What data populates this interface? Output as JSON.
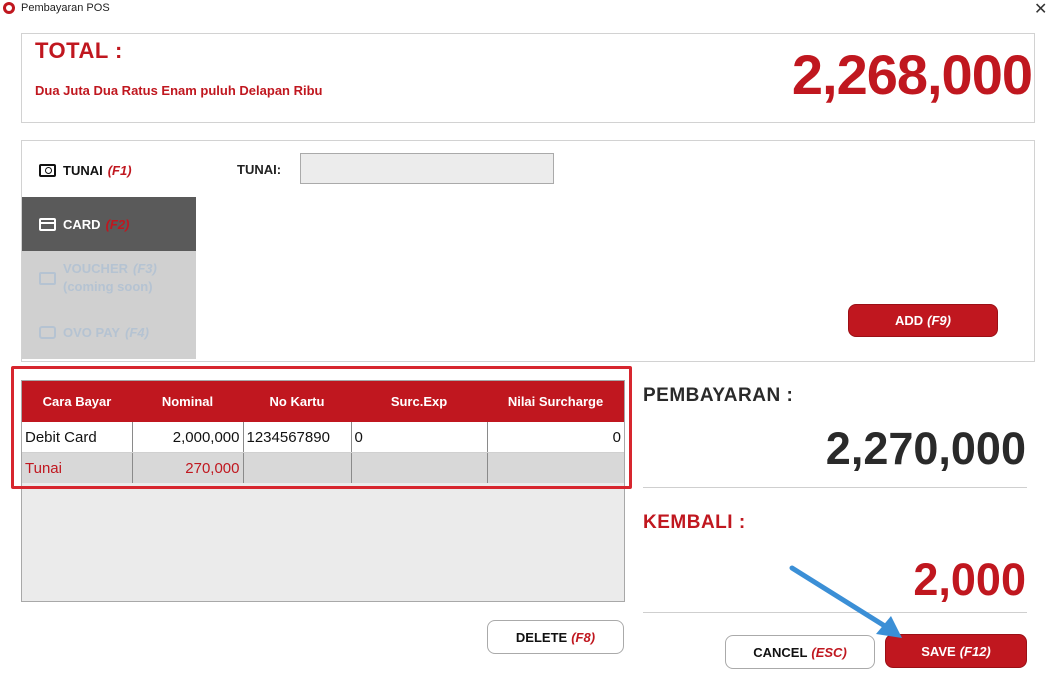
{
  "window": {
    "title": "Pembayaran POS",
    "close_glyph": "✕"
  },
  "total": {
    "label": "TOTAL :",
    "amount_words": "Dua Juta Dua Ratus Enam puluh Delapan Ribu",
    "amount": "2,268,000"
  },
  "methods": [
    {
      "label": "TUNAI",
      "key": "(F1)",
      "icon": "cash-icon"
    },
    {
      "label": "CARD",
      "key": "(F2)",
      "icon": "card-icon",
      "selected": true
    },
    {
      "label": "VOUCHER",
      "key": "(F3)",
      "sub": "(coming soon)",
      "icon": "voucher-icon",
      "disabled": true
    },
    {
      "label": "OVO PAY",
      "key": "(F4)",
      "icon": "wallet-icon",
      "disabled": true
    }
  ],
  "tunai_field": {
    "label": "TUNAI:",
    "value": ""
  },
  "buttons": {
    "add": {
      "label": "ADD",
      "key": "(F9)"
    },
    "delete": {
      "label": "DELETE",
      "key": "(F8)"
    },
    "cancel": {
      "label": "CANCEL",
      "key": "(ESC)"
    },
    "save": {
      "label": "SAVE",
      "key": "(F12)"
    }
  },
  "payments_table": {
    "columns": [
      "Cara Bayar",
      "Nominal",
      "No Kartu",
      "Surc.Exp",
      "Nilai Surcharge"
    ],
    "rows": [
      [
        "Debit Card",
        "2,000,000",
        "1234567890",
        "0",
        "0"
      ],
      [
        "Tunai",
        "270,000",
        "",
        "",
        ""
      ]
    ]
  },
  "summary": {
    "pembayaran_label": "PEMBAYARAN :",
    "pembayaran_amount": "2,270,000",
    "kembali_label": "KEMBALI :",
    "kembali_amount": "2,000"
  },
  "colors": {
    "accent": "#c0171f",
    "selected_tab": "#5a5a5a",
    "disabled_tab": "#d0d0d0",
    "annotation": "#3b8fd6"
  }
}
